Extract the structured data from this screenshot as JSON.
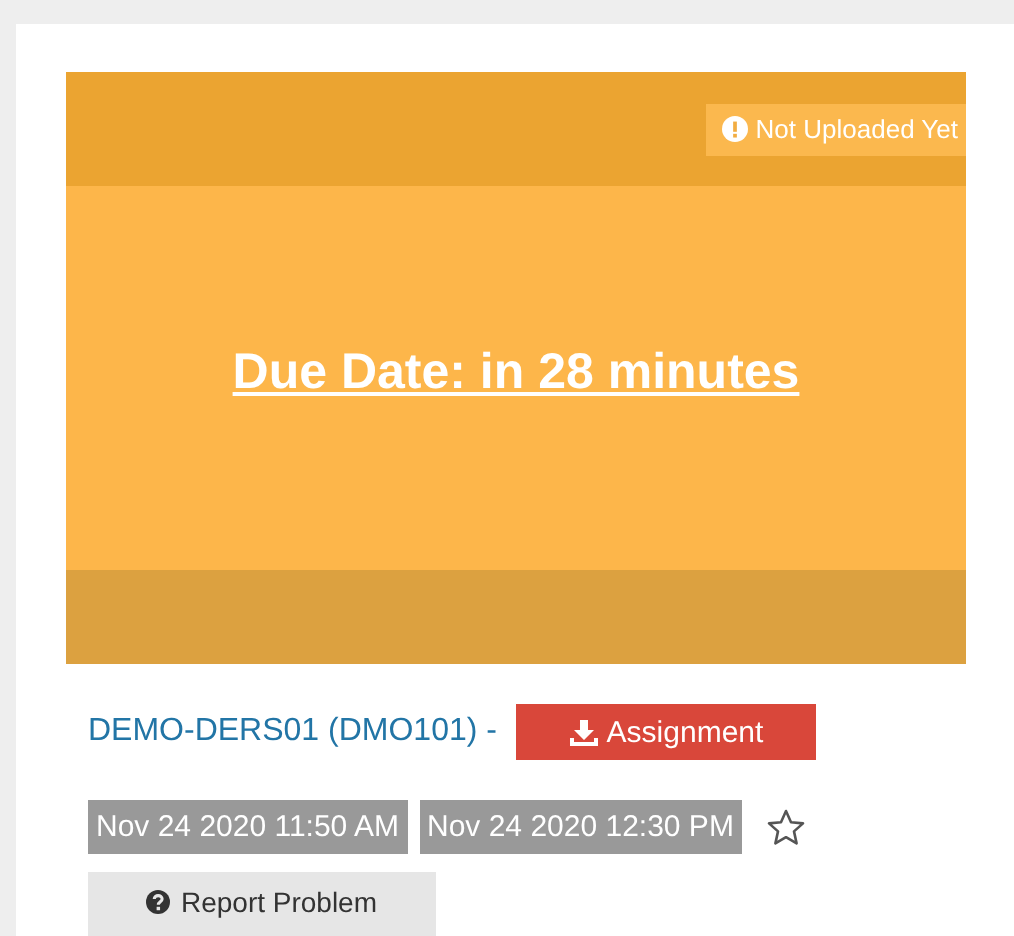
{
  "banner": {
    "status": {
      "label": "Not Uploaded Yet"
    },
    "due": "Due Date: in 28 minutes"
  },
  "course": {
    "title": "DEMO-DERS01 (DMO101) -",
    "download": {
      "label": "Assignment"
    }
  },
  "dates": [
    {
      "label": "Nov 24 2020 11:50 AM"
    },
    {
      "label": "Nov 24 2020 12:30 PM"
    }
  ],
  "favorite": {
    "starred": false
  },
  "report": {
    "label": "Report Problem"
  }
}
